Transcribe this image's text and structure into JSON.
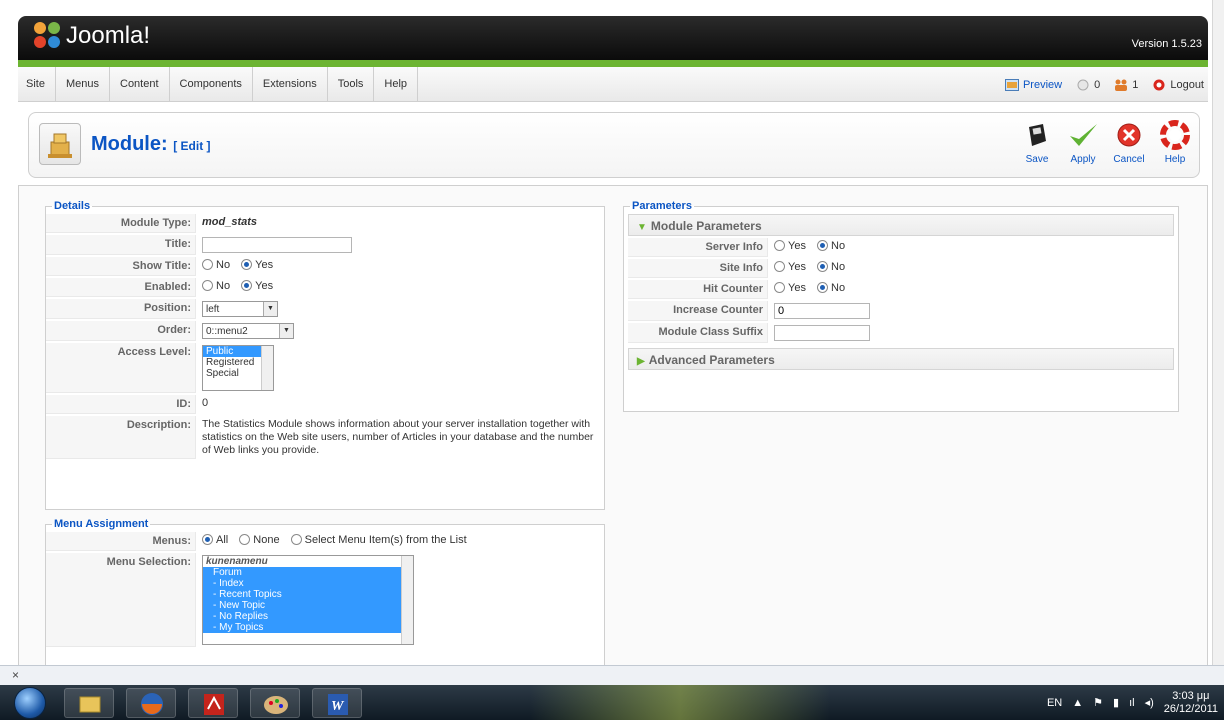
{
  "header": {
    "logo_text": "Joomla!",
    "version": "Version 1.5.23"
  },
  "menubar": {
    "items": [
      "Site",
      "Menus",
      "Content",
      "Components",
      "Extensions",
      "Tools",
      "Help"
    ],
    "preview_label": "Preview",
    "messages_count": "0",
    "users_count": "1",
    "logout_label": "Logout"
  },
  "toolbar": {
    "title": "Module:",
    "subtitle": "[ Edit ]",
    "buttons": [
      "Save",
      "Apply",
      "Cancel",
      "Help"
    ]
  },
  "details": {
    "legend": "Details",
    "module_type_label": "Module Type:",
    "module_type_value": "mod_stats",
    "title_label": "Title:",
    "title_value": "",
    "show_title_label": "Show Title:",
    "enabled_label": "Enabled:",
    "no_label": "No",
    "yes_label": "Yes",
    "position_label": "Position:",
    "position_value": "left",
    "order_label": "Order:",
    "order_value": "0::menu2",
    "access_label": "Access Level:",
    "access_options": [
      "Public",
      "Registered",
      "Special"
    ],
    "id_label": "ID:",
    "id_value": "0",
    "description_label": "Description:",
    "description_value": "The Statistics Module shows information about your server installation together with statistics on the Web site users, number of Articles in your database and the number of Web links you provide."
  },
  "menu_assignment": {
    "legend": "Menu Assignment",
    "menus_label": "Menus:",
    "opt_all": "All",
    "opt_none": "None",
    "opt_select": "Select Menu Item(s) from the List",
    "selection_label": "Menu Selection:",
    "list_header": "kunenamenu",
    "list_items": [
      "Forum",
      "- Index",
      "- Recent Topics",
      "- New Topic",
      "- No Replies",
      "- My Topics"
    ]
  },
  "parameters": {
    "legend": "Parameters",
    "module_params_title": "Module Parameters",
    "server_info_label": "Server Info",
    "site_info_label": "Site Info",
    "hit_counter_label": "Hit Counter",
    "yes_label": "Yes",
    "no_label": "No",
    "increase_counter_label": "Increase Counter",
    "increase_counter_value": "0",
    "class_suffix_label": "Module Class Suffix",
    "class_suffix_value": "",
    "advanced_params_title": "Advanced Parameters"
  },
  "addon_bar": {
    "close": "×"
  },
  "taskbar": {
    "lang": "EN",
    "time": "3:03 μμ",
    "date": "26/12/2011"
  },
  "colors": {
    "accent_blue": "#0b55c4",
    "joomla_green": "#6cb432"
  }
}
